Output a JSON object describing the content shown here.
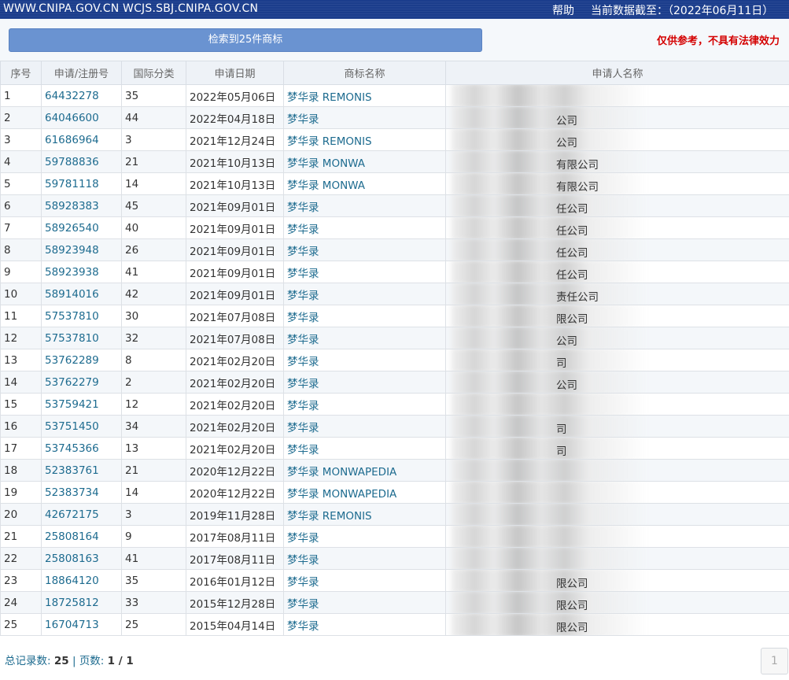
{
  "topbar": {
    "site": "WWW.CNIPA.GOV.CN WCJS.SBJ.CNIPA.GOV.CN",
    "help": "帮助",
    "as_of": "当前数据截至：（2022年06月11日）"
  },
  "panel": {
    "result_label": "检索到25件商标",
    "disclaimer": "仅供参考，不具有法律效力"
  },
  "table": {
    "headers": [
      "序号",
      "申请/注册号",
      "国际分类",
      "申请日期",
      "商标名称",
      "申请人名称"
    ],
    "rows": [
      {
        "no": "1",
        "reg": "64432278",
        "cls": "35",
        "date": "2022年05月06日",
        "name": "梦华录 REMONIS",
        "applicant_tail": ""
      },
      {
        "no": "2",
        "reg": "64046600",
        "cls": "44",
        "date": "2022年04月18日",
        "name": "梦华录",
        "applicant_tail": "公司"
      },
      {
        "no": "3",
        "reg": "61686964",
        "cls": "3",
        "date": "2021年12月24日",
        "name": "梦华录 REMONIS",
        "applicant_tail": "公司"
      },
      {
        "no": "4",
        "reg": "59788836",
        "cls": "21",
        "date": "2021年10月13日",
        "name": "梦华录 MONWA",
        "applicant_tail": "有限公司"
      },
      {
        "no": "5",
        "reg": "59781118",
        "cls": "14",
        "date": "2021年10月13日",
        "name": "梦华录 MONWA",
        "applicant_tail": "有限公司"
      },
      {
        "no": "6",
        "reg": "58928383",
        "cls": "45",
        "date": "2021年09月01日",
        "name": "梦华录",
        "applicant_tail": "任公司"
      },
      {
        "no": "7",
        "reg": "58926540",
        "cls": "40",
        "date": "2021年09月01日",
        "name": "梦华录",
        "applicant_tail": "任公司"
      },
      {
        "no": "8",
        "reg": "58923948",
        "cls": "26",
        "date": "2021年09月01日",
        "name": "梦华录",
        "applicant_tail": "任公司"
      },
      {
        "no": "9",
        "reg": "58923938",
        "cls": "41",
        "date": "2021年09月01日",
        "name": "梦华录",
        "applicant_tail": "任公司"
      },
      {
        "no": "10",
        "reg": "58914016",
        "cls": "42",
        "date": "2021年09月01日",
        "name": "梦华录",
        "applicant_tail": "责任公司"
      },
      {
        "no": "11",
        "reg": "57537810",
        "cls": "30",
        "date": "2021年07月08日",
        "name": "梦华录",
        "applicant_tail": "限公司"
      },
      {
        "no": "12",
        "reg": "57537810",
        "cls": "32",
        "date": "2021年07月08日",
        "name": "梦华录",
        "applicant_tail": "公司"
      },
      {
        "no": "13",
        "reg": "53762289",
        "cls": "8",
        "date": "2021年02月20日",
        "name": "梦华录",
        "applicant_tail": "司"
      },
      {
        "no": "14",
        "reg": "53762279",
        "cls": "2",
        "date": "2021年02月20日",
        "name": "梦华录",
        "applicant_tail": "公司"
      },
      {
        "no": "15",
        "reg": "53759421",
        "cls": "12",
        "date": "2021年02月20日",
        "name": "梦华录",
        "applicant_tail": ""
      },
      {
        "no": "16",
        "reg": "53751450",
        "cls": "34",
        "date": "2021年02月20日",
        "name": "梦华录",
        "applicant_tail": "司"
      },
      {
        "no": "17",
        "reg": "53745366",
        "cls": "13",
        "date": "2021年02月20日",
        "name": "梦华录",
        "applicant_tail": "司"
      },
      {
        "no": "18",
        "reg": "52383761",
        "cls": "21",
        "date": "2020年12月22日",
        "name": "梦华录 MONWAPEDIA",
        "applicant_tail": ""
      },
      {
        "no": "19",
        "reg": "52383734",
        "cls": "14",
        "date": "2020年12月22日",
        "name": "梦华录 MONWAPEDIA",
        "applicant_tail": ""
      },
      {
        "no": "20",
        "reg": "42672175",
        "cls": "3",
        "date": "2019年11月28日",
        "name": "梦华录 REMONIS",
        "applicant_tail": ""
      },
      {
        "no": "21",
        "reg": "25808164",
        "cls": "9",
        "date": "2017年08月11日",
        "name": "梦华录",
        "applicant_tail": ""
      },
      {
        "no": "22",
        "reg": "25808163",
        "cls": "41",
        "date": "2017年08月11日",
        "name": "梦华录",
        "applicant_tail": ""
      },
      {
        "no": "23",
        "reg": "18864120",
        "cls": "35",
        "date": "2016年01月12日",
        "name": "梦华录",
        "applicant_tail": "限公司"
      },
      {
        "no": "24",
        "reg": "18725812",
        "cls": "33",
        "date": "2015年12月28日",
        "name": "梦华录",
        "applicant_tail": "限公司"
      },
      {
        "no": "25",
        "reg": "16704713",
        "cls": "25",
        "date": "2015年04月14日",
        "name": "梦华录",
        "applicant_tail": "限公司"
      }
    ]
  },
  "footer": {
    "total_label": "总记录数:",
    "total_value": "25",
    "sep": "|",
    "pages_label": "页数:",
    "pages_value": "1 / 1"
  },
  "pager": {
    "page": "1"
  }
}
